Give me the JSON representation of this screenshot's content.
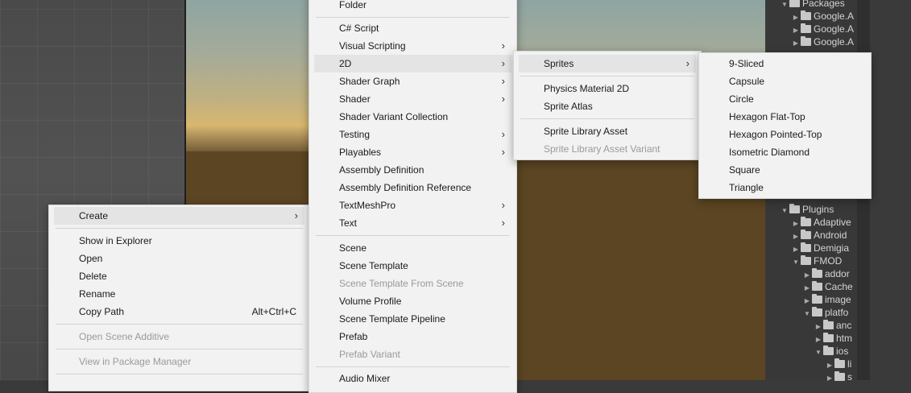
{
  "project_tree": [
    {
      "label": "Packages",
      "depth": 0,
      "open": true
    },
    {
      "label": "Google.A",
      "depth": 1,
      "open": false
    },
    {
      "label": "Google.A",
      "depth": 1,
      "open": false
    },
    {
      "label": "Google.A",
      "depth": 1,
      "open": false
    },
    {
      "label": "Plugins",
      "depth": 0,
      "open": true
    },
    {
      "label": "Adaptive",
      "depth": 1,
      "open": false
    },
    {
      "label": "Android",
      "depth": 1,
      "open": false
    },
    {
      "label": "Demigia",
      "depth": 1,
      "open": false
    },
    {
      "label": "FMOD",
      "depth": 1,
      "open": true
    },
    {
      "label": "addor",
      "depth": 2,
      "open": false
    },
    {
      "label": "Cache",
      "depth": 2,
      "open": false
    },
    {
      "label": "image",
      "depth": 2,
      "open": false
    },
    {
      "label": "platfo",
      "depth": 2,
      "open": true
    },
    {
      "label": "anc",
      "depth": 3,
      "open": false
    },
    {
      "label": "htm",
      "depth": 3,
      "open": false
    },
    {
      "label": "ios",
      "depth": 3,
      "open": true
    },
    {
      "label": "li",
      "depth": 4,
      "open": false
    },
    {
      "label": "s",
      "depth": 4,
      "open": false
    }
  ],
  "context_menu": {
    "create": "Create",
    "show_in_explorer": "Show in Explorer",
    "open": "Open",
    "delete": "Delete",
    "rename": "Rename",
    "copy_path": "Copy Path",
    "copy_path_shortcut": "Alt+Ctrl+C",
    "open_scene_additive": "Open Scene Additive",
    "view_in_package_manager": "View in Package Manager"
  },
  "create_menu": {
    "folder": "Folder",
    "csharp_script": "C# Script",
    "visual_scripting": "Visual Scripting",
    "two_d": "2D",
    "shader_graph": "Shader Graph",
    "shader": "Shader",
    "shader_variant_collection": "Shader Variant Collection",
    "testing": "Testing",
    "playables": "Playables",
    "assembly_definition": "Assembly Definition",
    "assembly_definition_reference": "Assembly Definition Reference",
    "textmeshpro": "TextMeshPro",
    "text": "Text",
    "scene": "Scene",
    "scene_template": "Scene Template",
    "scene_template_from_scene": "Scene Template From Scene",
    "volume_profile": "Volume Profile",
    "scene_template_pipeline": "Scene Template Pipeline",
    "prefab": "Prefab",
    "prefab_variant": "Prefab Variant",
    "audio_mixer": "Audio Mixer"
  },
  "menu_2d": {
    "sprites": "Sprites",
    "physics_material_2d": "Physics Material 2D",
    "sprite_atlas": "Sprite Atlas",
    "sprite_library_asset": "Sprite Library Asset",
    "sprite_library_asset_variant": "Sprite Library Asset Variant"
  },
  "sprites_menu": [
    "9-Sliced",
    "Capsule",
    "Circle",
    "Hexagon Flat-Top",
    "Hexagon Pointed-Top",
    "Isometric Diamond",
    "Square",
    "Triangle"
  ],
  "icons": {
    "submenu": "chevron-right-icon",
    "tree_open": "triangle-down-icon",
    "tree_closed": "triangle-right-icon",
    "folder": "folder-icon"
  }
}
